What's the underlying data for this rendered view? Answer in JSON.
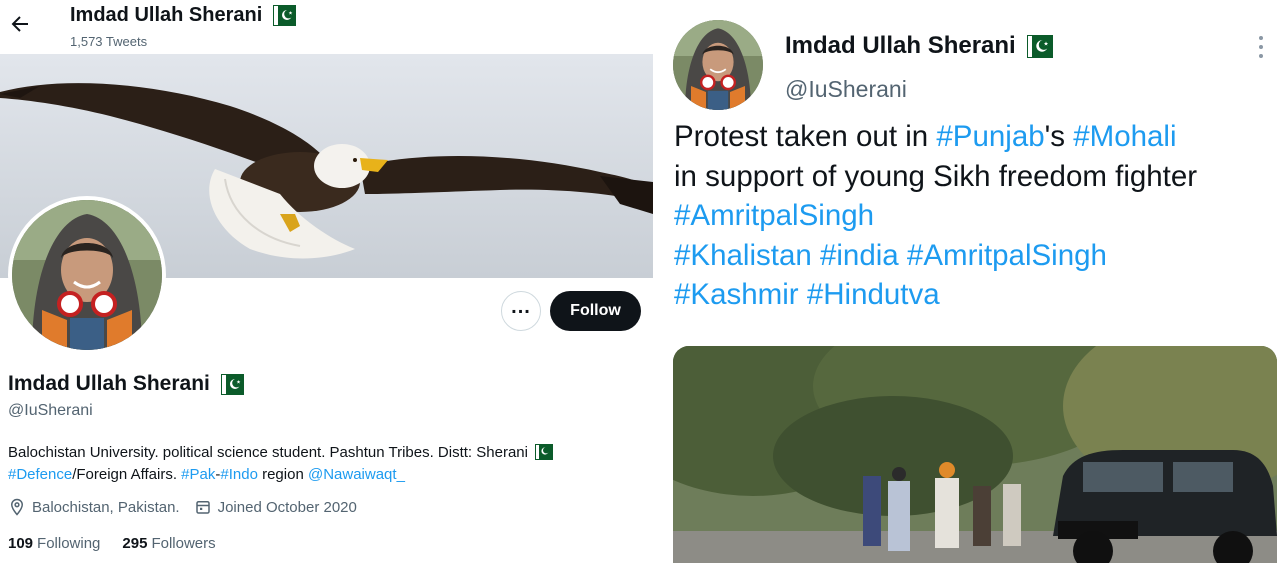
{
  "profile": {
    "header_name": "Imdad Ullah Sherani",
    "tweet_count": "1,573 Tweets",
    "name": "Imdad Ullah Sherani",
    "handle": "@IuSherani",
    "bio": {
      "line1": "Balochistan University. political science student. Pashtun Tribes. Distt: Sherani",
      "tag1": "#Defence",
      "text2": "/Foreign Affairs. ",
      "tag2": "#Pak",
      "dash": "-",
      "tag3": "#Indo",
      "text3": " region ",
      "mention": "@Nawaiwaqt_"
    },
    "location": "Balochistan, Pakistan.",
    "joined": "Joined October 2020",
    "following_count": "109",
    "following_label": "Following",
    "followers_count": "295",
    "followers_label": "Followers",
    "follow_label": "Follow",
    "more_label": "...",
    "icons": {
      "back": "arrow-left-icon",
      "location": "location-pin-icon",
      "calendar": "calendar-icon",
      "flag": "pakistan-flag-icon"
    }
  },
  "tweet": {
    "name": "Imdad Ullah Sherani",
    "handle": "@IuSherani",
    "text": {
      "p1": "Protest taken out in ",
      "h1": "#Punjab",
      "p2": "'s ",
      "h2": "#Mohali",
      "p3": "in support of young Sikh freedom fighter",
      "h3": "#AmritpalSingh",
      "h4": "#Khalistan",
      "h5": "#india",
      "h6": "#AmritpalSingh",
      "h7": "#Kashmir",
      "h8": "#Hindutva"
    }
  },
  "colors": {
    "link": "#1d9bf0",
    "text": "#0f1419",
    "muted": "#536471",
    "button": "#0f1419"
  }
}
